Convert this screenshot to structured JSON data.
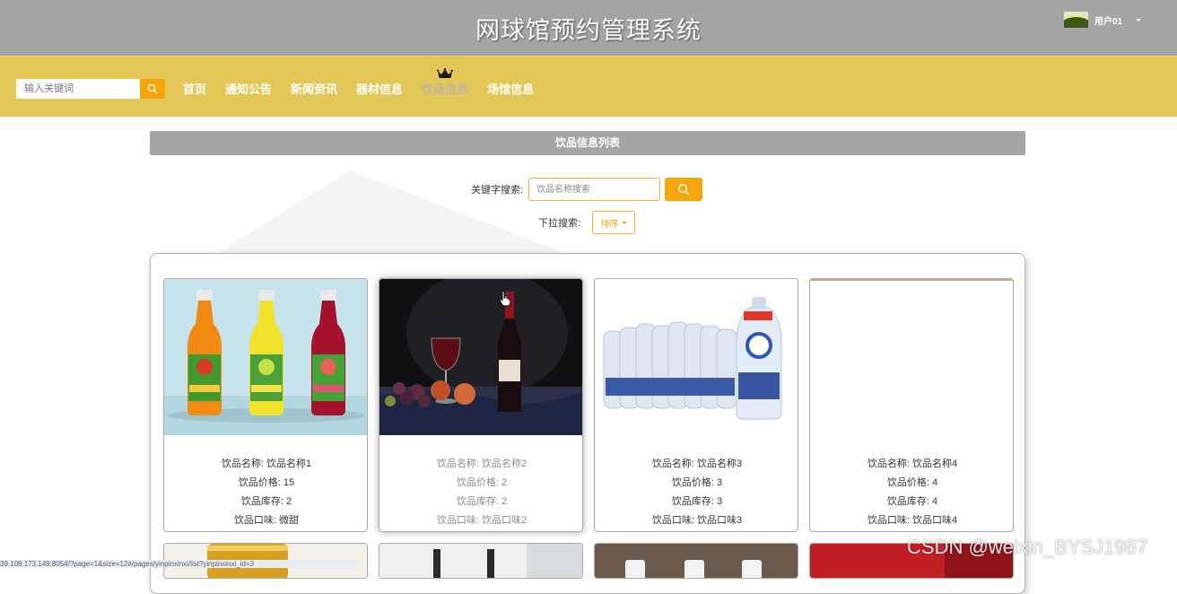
{
  "header": {
    "site_title": "网球馆预约管理系统",
    "username": "用户01"
  },
  "nav": {
    "search_placeholder": "输入关键词",
    "items": [
      {
        "label": "首页"
      },
      {
        "label": "通知公告"
      },
      {
        "label": "新闻资讯"
      },
      {
        "label": "器材信息"
      },
      {
        "label": "饮品信息",
        "active": true
      },
      {
        "label": "场馆信息"
      }
    ],
    "accent_color": "#e3c858",
    "button_color": "#f5a60c"
  },
  "list": {
    "title": "饮品信息列表",
    "keyword_label": "关键字搜索:",
    "keyword_placeholder": "饮品名称搜索",
    "dropdown_label": "下拉搜索:",
    "sort_label": "排序"
  },
  "products": [
    {
      "name_label": "饮品名称: 饮品名称1",
      "price_label": "饮品价格: 15",
      "stock_label": "饮品库存: 2",
      "taste_label": "饮品口味: 微甜",
      "image": "juice-bottles"
    },
    {
      "name_label": "饮品名称: 饮品名称2",
      "price_label": "饮品价格: 2",
      "stock_label": "饮品库存: 2",
      "taste_label": "饮品口味: 饮品口味2",
      "image": "red-wine"
    },
    {
      "name_label": "饮品名称: 饮品名称3",
      "price_label": "饮品价格: 3",
      "stock_label": "饮品库存: 3",
      "taste_label": "饮品口味: 饮品口味3",
      "image": "lactic-acid-bottles"
    },
    {
      "name_label": "饮品名称: 饮品名称4",
      "price_label": "饮品价格: 4",
      "stock_label": "饮品库存: 4",
      "taste_label": "饮品口味: 饮品口味4",
      "image": "blank"
    }
  ],
  "status_url": "39.108.173.149:8054/?page=1&size=12#/pages/yinpinxinxi/list?yinpinxinxi_id=3",
  "watermark": "CSDN @weixin_BYSJ1987"
}
